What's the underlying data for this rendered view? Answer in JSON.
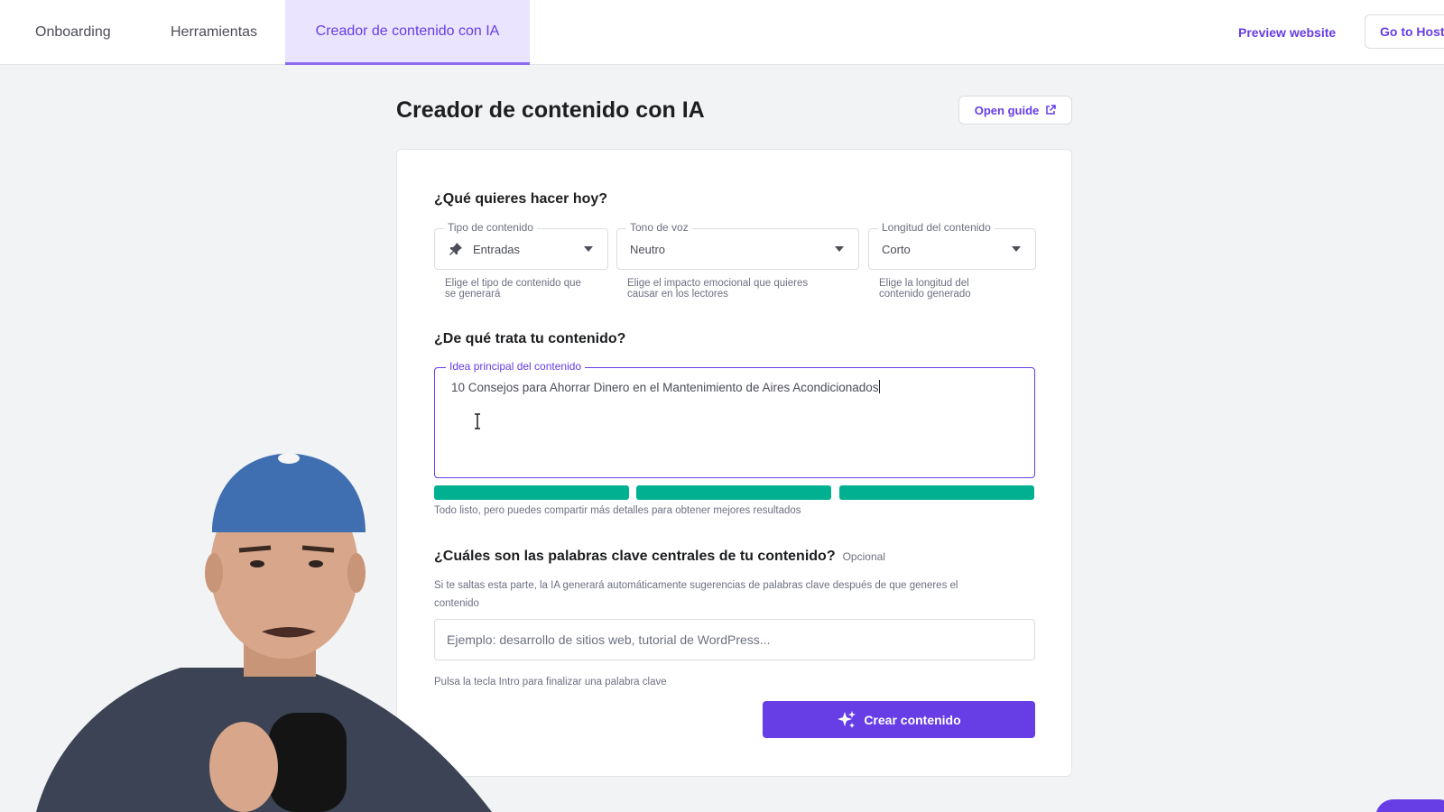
{
  "nav": {
    "tabs": [
      {
        "label": "Onboarding",
        "active": false
      },
      {
        "label": "Herramientas",
        "active": false
      },
      {
        "label": "Creador de contenido con IA",
        "active": true
      }
    ],
    "preview_label": "Preview website",
    "hostinger_label": "Go to Host"
  },
  "page": {
    "title": "Creador de contenido con IA",
    "guide_label": "Open guide"
  },
  "form": {
    "q1": "¿Qué quieres hacer hoy?",
    "content_type": {
      "label": "Tipo de contenido",
      "value": "Entradas",
      "icon": "pin-icon",
      "helper": [
        "Elige el tipo de contenido que",
        "se generará"
      ]
    },
    "tone": {
      "label": "Tono de voz",
      "value": "Neutro",
      "helper": [
        "Elige el impacto emocional que quieres",
        "causar en los lectores"
      ]
    },
    "length": {
      "label": "Longitud del contenido",
      "value": "Corto",
      "helper": [
        "Elige la longitud del",
        "contenido generado"
      ]
    },
    "q2": "¿De qué trata tu contenido?",
    "idea": {
      "label": "Idea principal del contenido",
      "value": "10 Consejos para Ahorrar Dinero en el Mantenimiento de Aires Acondicionados"
    },
    "quality_hint": "Todo listo, pero puedes compartir más detalles para obtener mejores resultados",
    "quality_level": 1.0,
    "q3": "¿Cuáles son las palabras clave centrales de tu contenido?",
    "q3_optional": "Opcional",
    "keywords_desc_1": "Si te saltas esta parte, la IA generará automáticamente sugerencias de palabras clave después de que generes el",
    "keywords_desc_2": "contenido",
    "keywords_placeholder": "Ejemplo: desarrollo de sitios web, tutorial de WordPress...",
    "keywords_hint": "Pulsa la tecla Intro para finalizar una palabra clave",
    "create_label": "Crear contenido"
  },
  "colors": {
    "accent": "#673de6",
    "success": "#00b090"
  }
}
